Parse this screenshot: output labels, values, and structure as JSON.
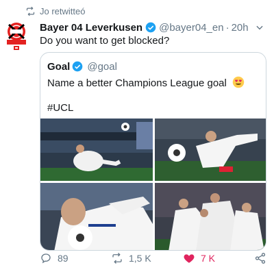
{
  "retweet_context": {
    "label": "Jo retwitteó",
    "icon": "retweet-icon"
  },
  "tweet": {
    "author_name": "Bayer 04 Leverkusen",
    "handle": "@bayer04_en",
    "separator": "·",
    "time": "20h",
    "text": "Do you want to get blocked?",
    "avatar": {
      "text": "BAYER 04 LEVERKUSEN",
      "colors": {
        "red": "#e32221",
        "black": "#000000"
      }
    }
  },
  "quote": {
    "author_name": "Goal",
    "handle": "@goal",
    "text": "Name a better Champions League goal",
    "emoji": "heart-eyes-emoji",
    "hashtag": "#UCL",
    "media": [
      {
        "icon": "photo-zidane-volley-wide"
      },
      {
        "icon": "photo-zidane-volley-close"
      },
      {
        "icon": "photo-zidane-face-ball"
      },
      {
        "icon": "photo-team-celebration"
      }
    ]
  },
  "actions": {
    "reply_count": "89",
    "retweet_count": "1,5 K",
    "like_count": "7 K",
    "share_icon": "share-icon"
  },
  "colors": {
    "accent": "#1da1f2",
    "muted": "#657786",
    "like": "#e0245e",
    "border": "#ccd6dd"
  }
}
